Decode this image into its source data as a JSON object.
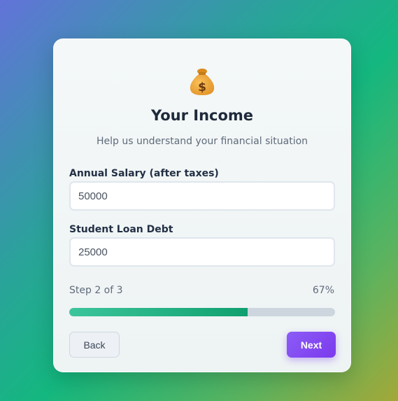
{
  "header": {
    "icon": "money-bag-icon",
    "title": "Your Income",
    "subtitle": "Help us understand your financial situation"
  },
  "form": {
    "salary": {
      "label": "Annual Salary (after taxes)",
      "value": "50000"
    },
    "debt": {
      "label": "Student Loan Debt",
      "value": "25000"
    }
  },
  "progress": {
    "step_text": "Step 2 of 3",
    "percent_text": "67%",
    "fraction": 0.67
  },
  "actions": {
    "back_label": "Back",
    "next_label": "Next"
  },
  "colors": {
    "accent": "#7c3aed",
    "progress": "#10a06f"
  }
}
